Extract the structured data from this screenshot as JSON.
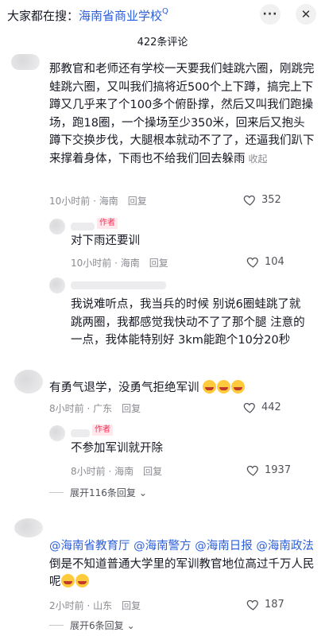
{
  "header": {
    "search_prefix": "大家都在搜：",
    "search_keyword": "海南省商业学校",
    "search_icon": "Q",
    "more_icon": "···",
    "close_icon": "✕"
  },
  "comment_count": "422条评论",
  "comments": [
    {
      "text": "那教官和老师还有学校一天要我们蛙跳六圈，刚跳完蛙跳六圈，又叫我们搞将近500个上下蹲，搞完上下蹲又几乎来了个100多个俯卧撑，然后又叫我们跑操场，跑18圈，一个操场至少350米，回来后又抱头蹲下交换步伐，大腿根本就动不了了，还逼我们趴下来撑着身体，下雨也不给我们回去躲雨",
      "collapse": "收起",
      "time": "10小时前 · 海南",
      "reply": "回复",
      "likes": "352"
    },
    {
      "author_tag": "作者",
      "text": "对下雨还要训",
      "time": "10小时前 · 海南",
      "reply": "回复",
      "likes": "104"
    },
    {
      "text": "我说难听点，我当兵的时候 别说6圈蛙跳了就跳两圈，我都感觉我快动不了了那个腿 注意的一点，我体能特别好 3km能跑个10分20秒",
      "time": "",
      "reply": "",
      "likes": ""
    },
    {
      "text": "有勇气退学，没勇气拒绝军训",
      "time": "8小时前 · 广东",
      "reply": "回复",
      "likes": "442"
    },
    {
      "author_tag": "作者",
      "text": "不参加军训就开除",
      "time": "8小时前 · 海南",
      "reply": "回复",
      "likes": "1937"
    },
    {
      "mentions": [
        "@海南省教育厅",
        "@海南警方",
        "@海南日报",
        "@海南政法"
      ],
      "text": "倒是不知道普通大学里的军训教官地位高过千万人民呢",
      "time": "2小时前 · 山东",
      "reply": "回复",
      "likes": "187"
    }
  ],
  "expand_1": "展开116条回复",
  "expand_2": "展开6条回复",
  "colors": {
    "link": "#2b5fd9",
    "meta": "#8a8b91",
    "author_tag": "#fe2c55"
  }
}
